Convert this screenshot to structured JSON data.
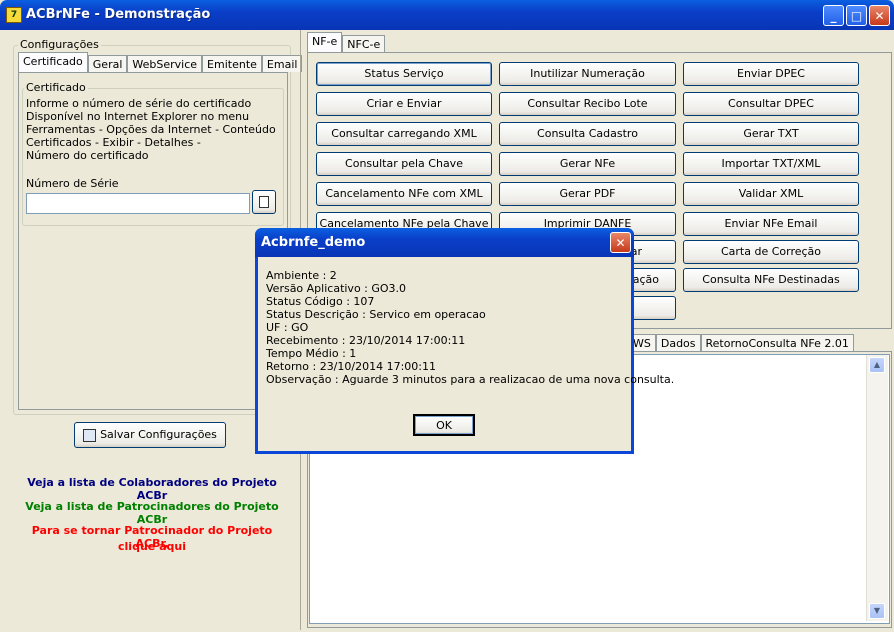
{
  "window": {
    "title": "ACBrNFe - Demonstração",
    "icon_name": "acbr-app-icon"
  },
  "config": {
    "group_label": "Configurações",
    "tabs": [
      "Certificado",
      "Geral",
      "WebService",
      "Emitente",
      "Email"
    ],
    "cert_group_label": "Certificado",
    "cert_info_lines": [
      "Informe o número de série do certificado",
      "Disponível no Internet Explorer no menu",
      "Ferramentas - Opções da Internet - Conteúdo",
      "Certificados - Exibir - Detalhes -",
      "Número do certificado"
    ],
    "serial_label": "Número de Série",
    "serial_value": "",
    "save_label": "Salvar Configurações"
  },
  "links": {
    "colaboradores": "Veja a lista de Colaboradores do Projeto ACBr",
    "patrocinadores": "Veja a lista de Patrocinadores do Projeto ACBr",
    "patrocinador_line1": "Para se tornar Patrocinador do Projeto ACBr,",
    "patrocinador_line2": "clique aqui",
    "colors": {
      "blue": "#000080",
      "green": "#008000",
      "red": "#FF0000"
    }
  },
  "main": {
    "tabs": [
      "NF-e",
      "NFC-e"
    ],
    "buttons_col1": [
      "Status Serviço",
      "Criar e Enviar",
      "Consultar carregando XML",
      "Consultar pela Chave",
      "Cancelamento NFe com XML",
      "Cancelamento NFe pela Chave"
    ],
    "buttons_col2": [
      "Inutilizar Numeração",
      "Consultar Recibo Lote",
      "Consulta Cadastro",
      "Gerar NFe",
      "Gerar PDF",
      "Imprimir DANFE",
      "",
      "",
      ""
    ],
    "buttons_col2_partial": [
      "ar",
      "ação"
    ],
    "buttons_col3": [
      "Enviar DPEC",
      "Consultar DPEC",
      "Gerar TXT",
      "Importar TXT/XML",
      "Validar XML",
      "Enviar NFe Email",
      "Carta de Correção",
      "Consulta NFe Destinadas"
    ],
    "result_tabs_partial": "WS",
    "result_tabs": [
      "Dados",
      "RetornoConsulta NFe 2.01"
    ]
  },
  "dialog": {
    "title": "Acbrnfe_demo",
    "lines": [
      "Ambiente : 2",
      "Versão Aplicativo : GO3.0",
      "Status Código : 107",
      "Status Descrição : Servico em operacao",
      "UF : GO",
      "Recebimento : 23/10/2014 17:00:11",
      "Tempo Médio : 1",
      "Retorno : 23/10/2014 17:00:11",
      "Observação : Aguarde 3 minutos para a realizacao de uma nova consulta."
    ],
    "ok_label": "OK"
  }
}
